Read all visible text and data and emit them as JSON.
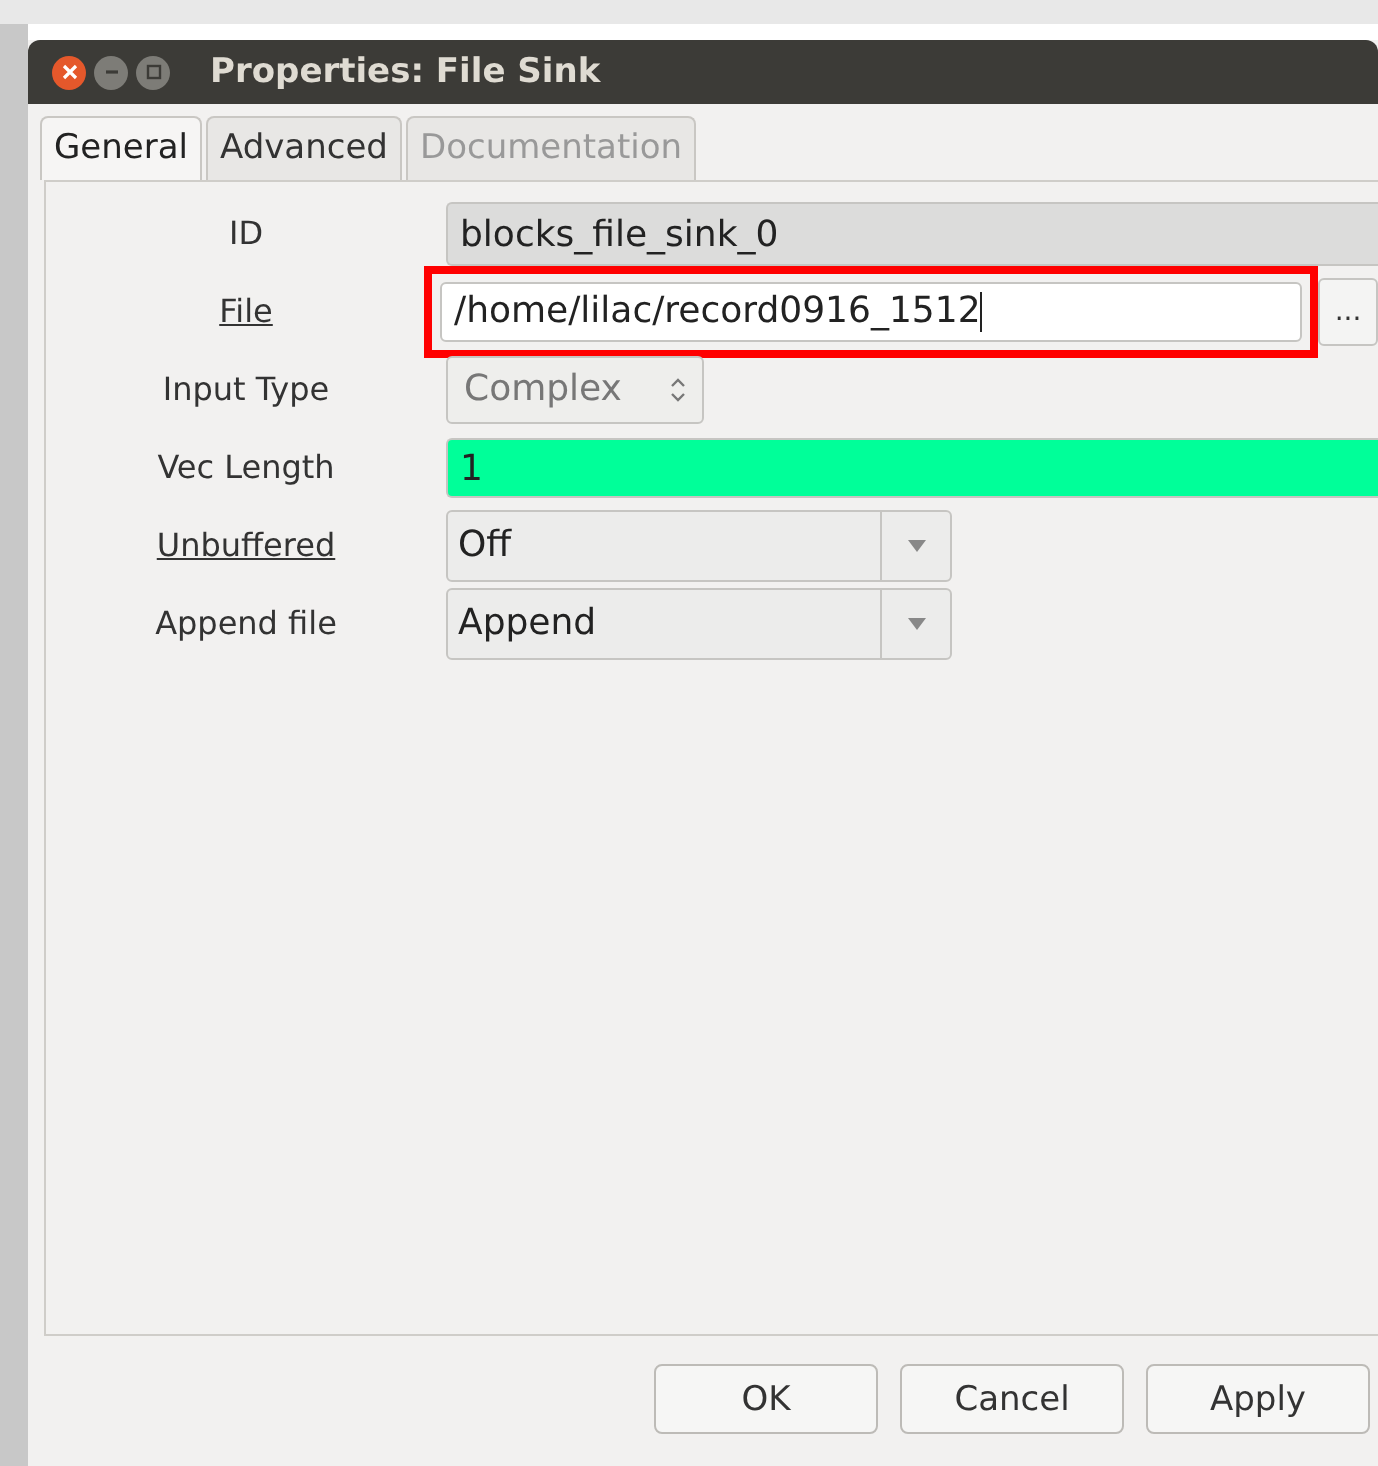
{
  "window": {
    "title": "Properties: File Sink"
  },
  "tabs": [
    {
      "label": "General",
      "selected": true,
      "disabled": false
    },
    {
      "label": "Advanced",
      "selected": false,
      "disabled": false
    },
    {
      "label": "Documentation",
      "selected": false,
      "disabled": true
    }
  ],
  "params": [
    {
      "label": "ID",
      "underlined": false,
      "kind": "readonly",
      "value": "blocks_file_sink_0"
    },
    {
      "label": "File",
      "underlined": true,
      "kind": "file",
      "value": "/home/lilac/record0916_1512",
      "highlighted": true,
      "browse": "..."
    },
    {
      "label": "Input Type",
      "underlined": false,
      "kind": "spin",
      "value": "Complex",
      "disabled": true
    },
    {
      "label": "Vec Length",
      "underlined": false,
      "kind": "entry",
      "value": "1",
      "color": "#00ff99"
    },
    {
      "label": "Unbuffered",
      "underlined": true,
      "kind": "combo",
      "value": "Off"
    },
    {
      "label": "Append file",
      "underlined": false,
      "kind": "combo",
      "value": "Append"
    }
  ],
  "buttons": [
    "OK",
    "Cancel",
    "Apply"
  ]
}
